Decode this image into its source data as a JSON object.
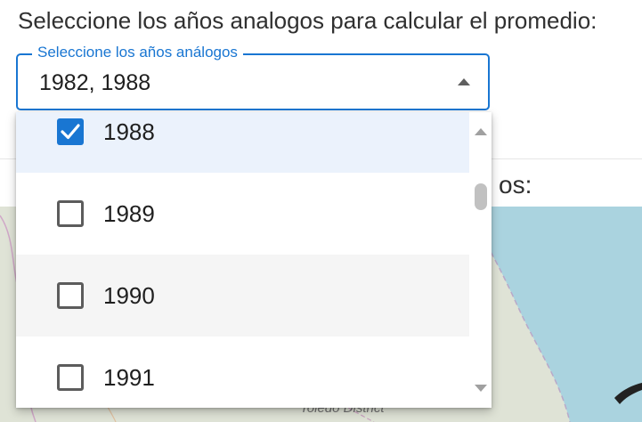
{
  "prompt": {
    "text": "Seleccione los años analogos para calcular el promedio:"
  },
  "select": {
    "label": "Seleccione los años análogos",
    "value": "1982, 1988",
    "accent_color": "#1976d2",
    "arrow_icon": "arrow-up-icon"
  },
  "menu": {
    "items": [
      {
        "label": "1988",
        "checked": true
      },
      {
        "label": "1989",
        "checked": false
      },
      {
        "label": "1990",
        "checked": false
      },
      {
        "label": "1991",
        "checked": false
      }
    ]
  },
  "background": {
    "heading_fragment": "os:",
    "map_label": "Toledo District",
    "water_color": "#aad3df",
    "land_color": "#dfe3d6"
  }
}
